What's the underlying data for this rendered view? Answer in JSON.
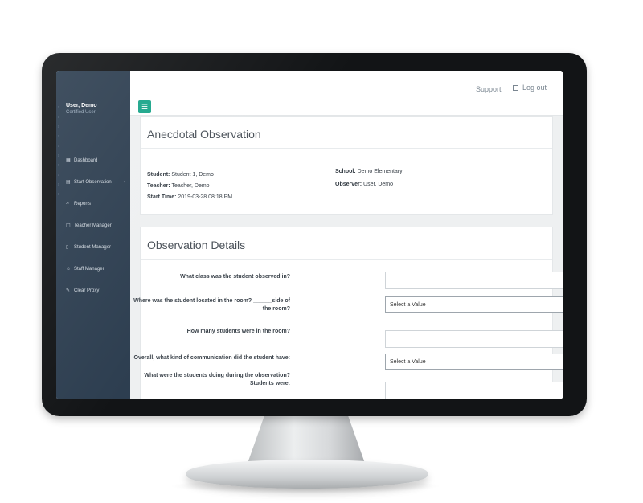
{
  "sidebar": {
    "user_name": "User, Demo",
    "user_role": "Certified User",
    "items": [
      {
        "label": "Dashboard",
        "icon": "dashboard-icon"
      },
      {
        "label": "Start Observation",
        "icon": "document-icon"
      },
      {
        "label": "Reports",
        "icon": "chart-icon"
      },
      {
        "label": "Teacher Manager",
        "icon": "chat-icon"
      },
      {
        "label": "Student Manager",
        "icon": "student-icon"
      },
      {
        "label": "Staff Manager",
        "icon": "users-icon"
      },
      {
        "label": "Clear Proxy",
        "icon": "broom-icon"
      }
    ]
  },
  "topbar": {
    "menu_icon": "☰",
    "support": "Support",
    "logout": "Log out"
  },
  "observation": {
    "title": "Anecdotal Observation",
    "student_label": "Student:",
    "student": "Student 1, Demo",
    "teacher_label": "Teacher:",
    "teacher": "Teacher, Demo",
    "start_label": "Start Time:",
    "start": "2019-03-28 08:18 PM",
    "school_label": "School:",
    "school": "Demo Elementary",
    "observer_label": "Observer:",
    "observer": "User, Demo"
  },
  "details": {
    "title": "Observation Details",
    "questions": [
      {
        "label": "What class was the student observed in?",
        "type": "text",
        "value": ""
      },
      {
        "label_line1": "Where was the student located in the room? ______side of",
        "label_line2": "the room?",
        "type": "select",
        "value": "Select a Value"
      },
      {
        "label": "How many students were in the room?",
        "type": "text",
        "value": ""
      },
      {
        "label": "Overall, what kind of communication did the student have:",
        "type": "select",
        "value": "Select a Value"
      },
      {
        "label_line1": "What were the students doing during the observation?",
        "label_line2": "Students were:",
        "type": "text",
        "value": ""
      }
    ]
  },
  "colors": {
    "sidebar": "#2d3e50",
    "accent": "#1aa58a",
    "bezel": "#121416"
  }
}
